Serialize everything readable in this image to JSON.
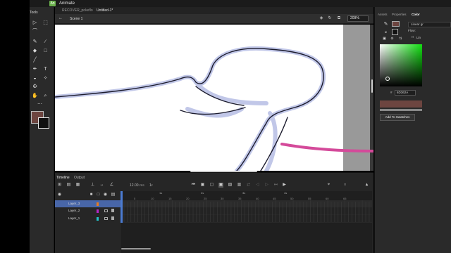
{
  "app": {
    "name": "Animate",
    "icon_text": "An"
  },
  "tools_panel": {
    "title": "Tools"
  },
  "document": {
    "tabs": [
      {
        "label": "RECOVER_pokeflo"
      },
      {
        "label": "Untitled-1*"
      }
    ],
    "scene": "Scene 1",
    "zoom": "209%"
  },
  "timeline": {
    "tabs": [
      "Timeline",
      "Output"
    ],
    "fps": "12.00",
    "fps_unit": "FPS",
    "current_frame": "1",
    "frame_unit": "F",
    "second_labels": [
      "1s",
      "2s",
      "3s",
      "4s"
    ],
    "frame_numbers": [
      "5",
      "10",
      "15",
      "20",
      "25",
      "30",
      "35",
      "40",
      "45",
      "50",
      "55",
      "60",
      "65"
    ],
    "layers": [
      {
        "name": "Layer_3",
        "color": "#e87a1e",
        "selected": true
      },
      {
        "name": "Layer_2",
        "color": "#b526c8",
        "selected": false
      },
      {
        "name": "Layer_1",
        "color": "#22c1c8",
        "selected": false
      }
    ]
  },
  "right_panel": {
    "tabs": [
      "Assets",
      "Properties",
      "Color"
    ],
    "color_type": "Linear gr",
    "flow_label": "Flow:",
    "linear_label": "Lin",
    "hex_prefix": "#",
    "hex_value": "6D362A",
    "add_swatch_label": "Add To Swatches"
  },
  "colors": {
    "stroke": "#6d4540",
    "fill": "#111111",
    "accent": "#4866a8",
    "stage_stroke": "#1c1c2e",
    "stage_glow": "#8f9ad6",
    "brush": "#d44a9a"
  }
}
